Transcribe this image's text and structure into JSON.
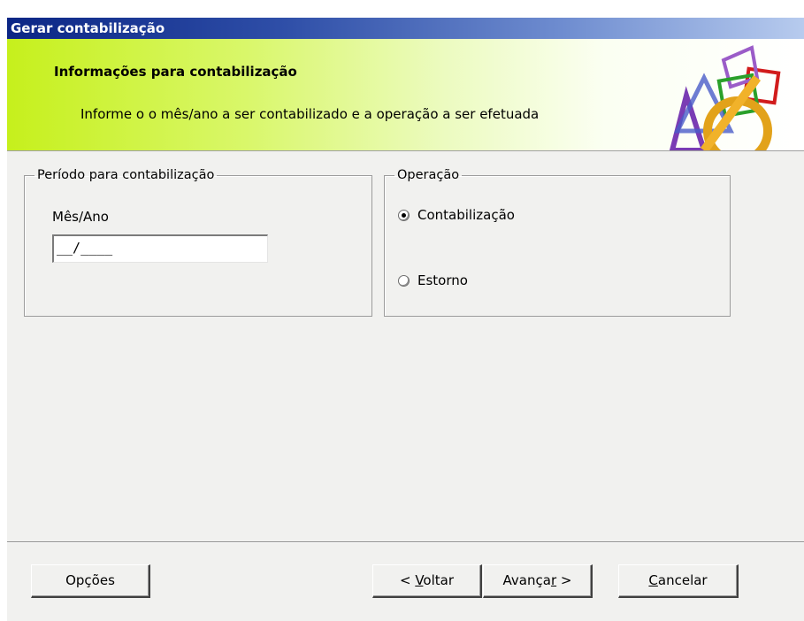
{
  "window": {
    "title": "Gerar contabilização"
  },
  "banner": {
    "title": "Informações para contabilização",
    "subtitle": "Informe o o mês/ano a ser contabilizado e a operação a ser efetuada",
    "art_icon": "geometric-shapes-logo"
  },
  "periodo": {
    "legend": "Período para contabilização",
    "field_label": "Mês/Ano",
    "field_value": "__/____"
  },
  "operacao": {
    "legend": "Operação",
    "options": [
      {
        "label": "Contabilização",
        "selected": true
      },
      {
        "label": "Estorno",
        "selected": false
      }
    ]
  },
  "buttons": {
    "opcoes": "Opções",
    "voltar_pre": "< ",
    "voltar_key": "V",
    "voltar_post": "oltar",
    "avancar_pre": "Avança",
    "avancar_key": "r",
    "avancar_post": " >",
    "cancelar_key": "C",
    "cancelar_post": "ancelar"
  }
}
